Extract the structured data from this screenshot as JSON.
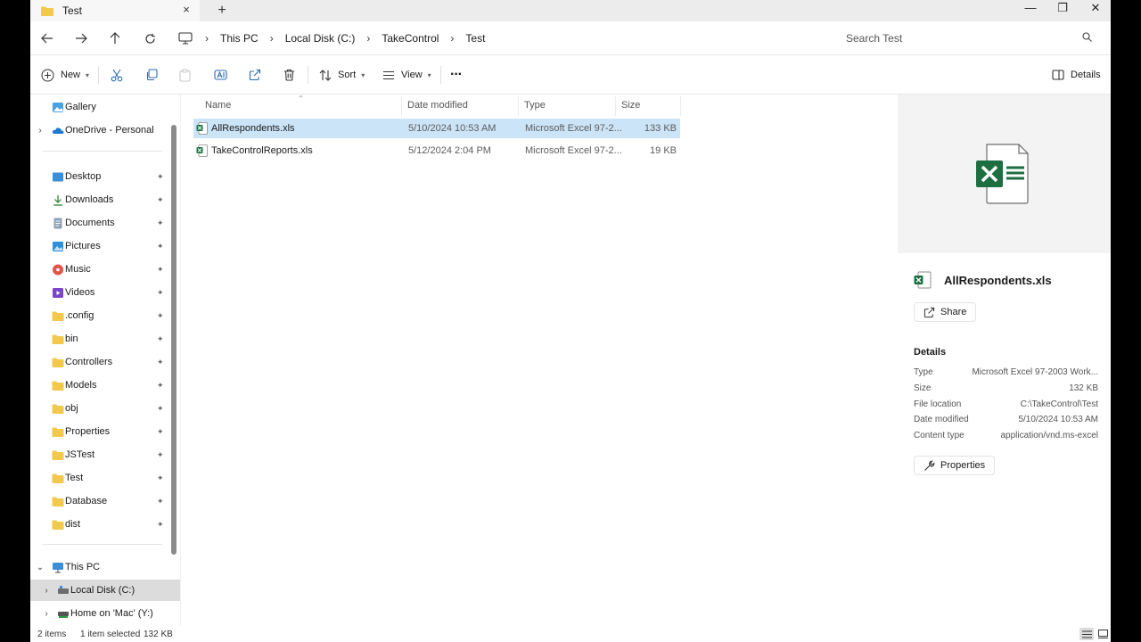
{
  "tab": {
    "title": "Test",
    "close_icon": "×",
    "new_tab_icon": "+"
  },
  "window_controls": {
    "minimize": "—",
    "maximize": "❐",
    "close": "✕"
  },
  "address": {
    "breadcrumbs": [
      "This PC",
      "Local Disk (C:)",
      "TakeControl",
      "Test"
    ],
    "separator": "›",
    "search_placeholder": "Search Test"
  },
  "toolbar": {
    "new_label": "New",
    "sort_label": "Sort",
    "view_label": "View",
    "more_label": "···",
    "details_label": "Details"
  },
  "nav": {
    "items": [
      {
        "label": "Gallery",
        "icon": "gallery-icon",
        "pinned": false
      },
      {
        "label": "OneDrive - Personal",
        "icon": "onedrive-icon",
        "pinned": false
      },
      {
        "label": "Desktop",
        "icon": "desktop-icon",
        "pinned": true
      },
      {
        "label": "Downloads",
        "icon": "download-icon",
        "pinned": true
      },
      {
        "label": "Documents",
        "icon": "documents-icon",
        "pinned": true
      },
      {
        "label": "Pictures",
        "icon": "pictures-icon",
        "pinned": true
      },
      {
        "label": "Music",
        "icon": "music-icon",
        "pinned": true
      },
      {
        "label": "Videos",
        "icon": "videos-icon",
        "pinned": true
      },
      {
        "label": ".config",
        "icon": "folder-icon",
        "pinned": true
      },
      {
        "label": "bin",
        "icon": "folder-icon",
        "pinned": true
      },
      {
        "label": "Controllers",
        "icon": "folder-icon",
        "pinned": true
      },
      {
        "label": "Models",
        "icon": "folder-icon",
        "pinned": true
      },
      {
        "label": "obj",
        "icon": "folder-icon",
        "pinned": true
      },
      {
        "label": "Properties",
        "icon": "folder-icon",
        "pinned": true
      },
      {
        "label": "JSTest",
        "icon": "folder-icon",
        "pinned": true
      },
      {
        "label": "Test",
        "icon": "folder-icon",
        "pinned": true
      },
      {
        "label": "Database",
        "icon": "folder-icon",
        "pinned": true
      },
      {
        "label": "dist",
        "icon": "folder-icon",
        "pinned": true
      },
      {
        "label": "This PC",
        "icon": "pc-icon",
        "pinned": false
      },
      {
        "label": "Local Disk (C:)",
        "icon": "drive-icon",
        "pinned": false
      },
      {
        "label": "Home on 'Mac' (Y:)",
        "icon": "network-drive-icon",
        "pinned": false
      }
    ],
    "pin_glyph": "📌"
  },
  "list": {
    "columns": [
      "Name",
      "Date modified",
      "Type",
      "Size"
    ],
    "rows": [
      {
        "name": "AllRespondents.xls",
        "date": "5/10/2024 10:53 AM",
        "type": "Microsoft Excel 97-2...",
        "size": "133 KB",
        "selected": true
      },
      {
        "name": "TakeControlReports.xls",
        "date": "5/12/2024 2:04 PM",
        "type": "Microsoft Excel 97-2...",
        "size": "19 KB",
        "selected": false
      }
    ]
  },
  "details": {
    "file_name": "AllRespondents.xls",
    "share_label": "Share",
    "section_title": "Details",
    "props": [
      {
        "key": "Type",
        "value": "Microsoft Excel 97-2003 Work..."
      },
      {
        "key": "Size",
        "value": "132 KB"
      },
      {
        "key": "File location",
        "value": "C:\\TakeControl\\Test"
      },
      {
        "key": "Date modified",
        "value": "5/10/2024 10:53 AM"
      },
      {
        "key": "Content type",
        "value": "application/vnd.ms-excel"
      }
    ],
    "properties_label": "Properties"
  },
  "status": {
    "count": "2 items",
    "selection": "1 item selected",
    "size": "132 KB"
  },
  "colors": {
    "selection": "#cce4f7",
    "excel_green": "#1d6f42",
    "folder_yellow": "#f2c94c"
  }
}
